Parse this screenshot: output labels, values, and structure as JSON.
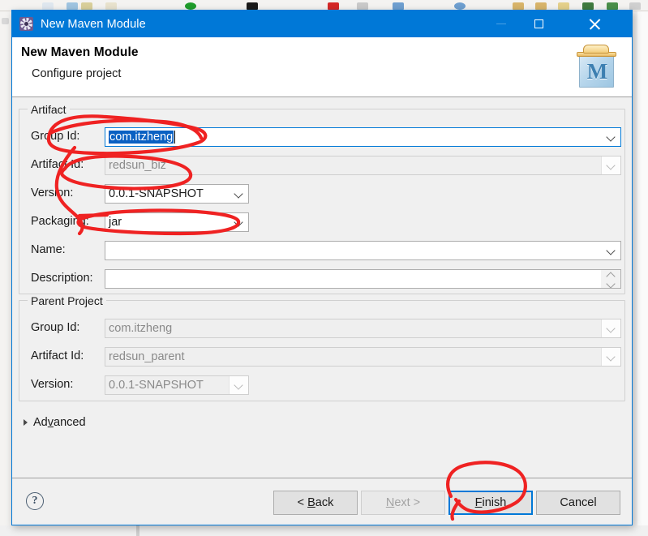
{
  "window": {
    "title": "New Maven Module",
    "icon": "gear-icon",
    "minimize_label": "—",
    "maximize_label": "□",
    "close_label": "✕",
    "accent_color": "#0078d7"
  },
  "header": {
    "title": "New Maven Module",
    "subtitle": "Configure project",
    "logo_letter": "M",
    "logo_name": "maven-module-icon"
  },
  "artifact": {
    "legend": "Artifact",
    "fields": [
      {
        "label": "Group Id:",
        "value": "com.itzheng",
        "state": "focused-selected",
        "control": "combo"
      },
      {
        "label": "Artifact Id:",
        "value": "redsun_biz",
        "state": "disabled",
        "control": "combo"
      },
      {
        "label": "Version:",
        "value": "0.0.1-SNAPSHOT",
        "state": "enabled",
        "control": "combo"
      },
      {
        "label": "Packaging:",
        "value": "jar",
        "state": "enabled",
        "control": "combo"
      },
      {
        "label": "Name:",
        "value": "",
        "state": "enabled",
        "control": "combo"
      },
      {
        "label": "Description:",
        "value": "",
        "state": "enabled",
        "control": "spinner"
      }
    ]
  },
  "parent_project": {
    "legend": "Parent Project",
    "fields": [
      {
        "label": "Group Id:",
        "value": "com.itzheng",
        "state": "disabled",
        "control": "combo"
      },
      {
        "label": "Artifact Id:",
        "value": "redsun_parent",
        "state": "disabled",
        "control": "combo"
      },
      {
        "label": "Version:",
        "value": "0.0.1-SNAPSHOT",
        "state": "disabled",
        "control": "combo"
      }
    ]
  },
  "advanced": {
    "label_pre": "Ad",
    "label_mnemonic": "v",
    "label_post": "anced",
    "expanded": false
  },
  "footer": {
    "help_label": "?",
    "buttons": [
      {
        "name": "back",
        "pre": "< ",
        "mnemonic": "B",
        "post": "ack",
        "state": "enabled"
      },
      {
        "name": "next",
        "pre": "",
        "mnemonic": "N",
        "post": "ext >",
        "state": "disabled"
      },
      {
        "name": "finish",
        "pre": "",
        "mnemonic": "F",
        "post": "inish",
        "state": "default"
      },
      {
        "name": "cancel",
        "pre": "Cancel",
        "mnemonic": "",
        "post": "",
        "state": "enabled"
      }
    ]
  },
  "annotations": {
    "ink_color": "#ef2222",
    "marks": [
      "ellipse-around-group-id-and-artifact-id",
      "ellipse-around-artifact-id-row",
      "vertical-stroke-through-labels",
      "ellipse-around-packaging-combo",
      "ellipse-around-finish-button"
    ]
  }
}
